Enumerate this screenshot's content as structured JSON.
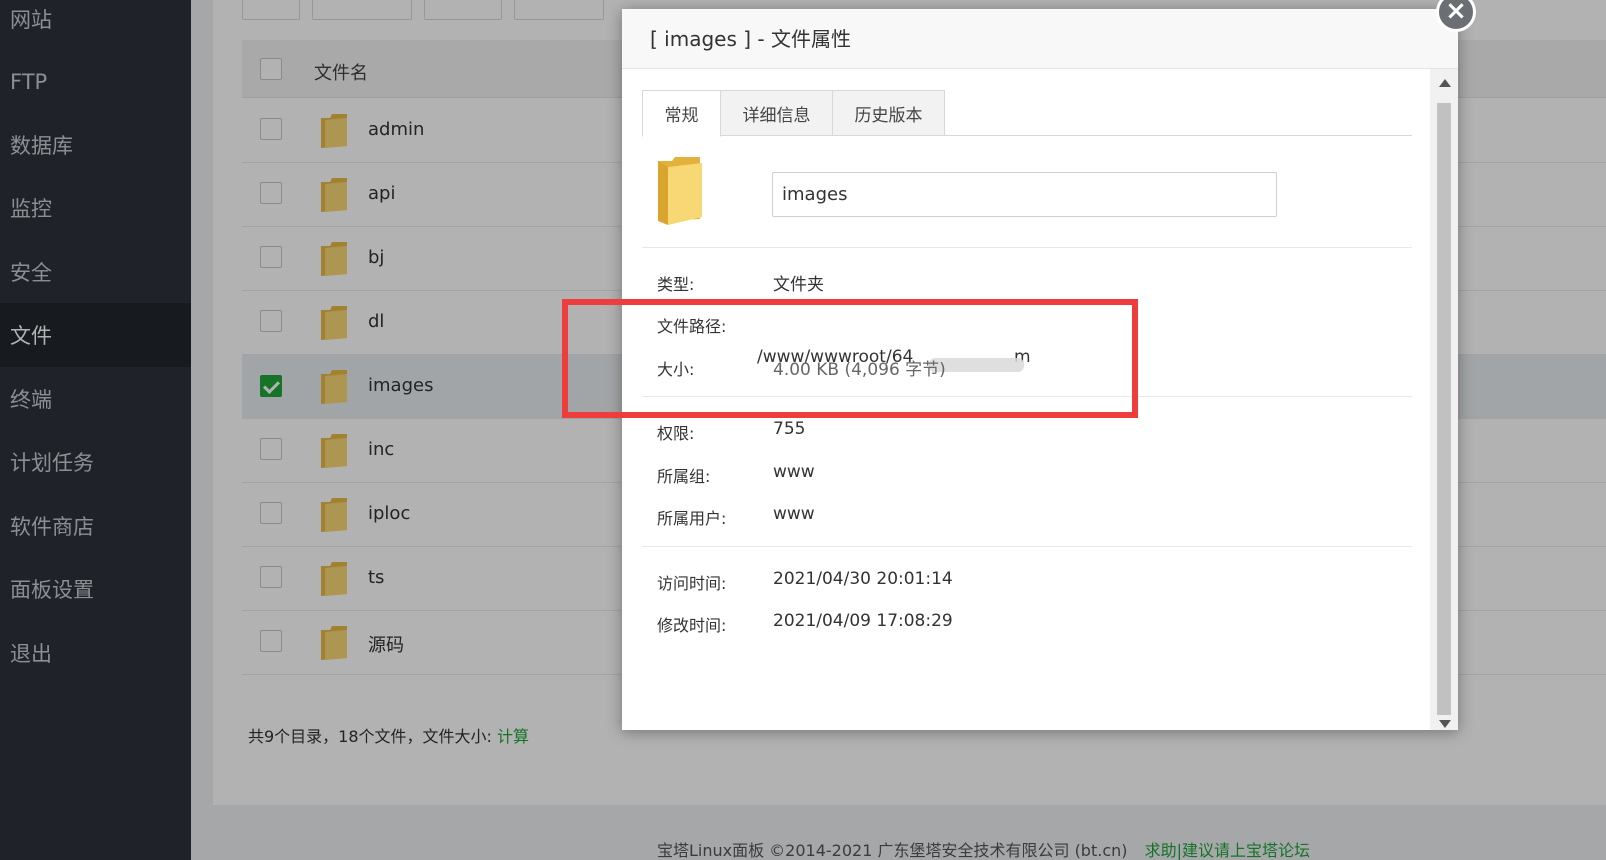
{
  "sidebar": {
    "items": [
      {
        "label": "网站"
      },
      {
        "label": "FTP"
      },
      {
        "label": "数据库"
      },
      {
        "label": "监控"
      },
      {
        "label": "安全"
      },
      {
        "label": "文件",
        "active": true
      },
      {
        "label": "终端"
      },
      {
        "label": "计划任务"
      },
      {
        "label": "软件商店"
      },
      {
        "label": "面板设置"
      },
      {
        "label": "退出"
      }
    ]
  },
  "file_list": {
    "header": {
      "name_col": "文件名"
    },
    "rows": [
      {
        "name": "admin",
        "checked": false
      },
      {
        "name": "api",
        "checked": false
      },
      {
        "name": "bj",
        "checked": false
      },
      {
        "name": "dl",
        "checked": false
      },
      {
        "name": "images",
        "checked": true
      },
      {
        "name": "inc",
        "checked": false
      },
      {
        "name": "iploc",
        "checked": false
      },
      {
        "name": "ts",
        "checked": false
      },
      {
        "name": "源码",
        "checked": false
      }
    ],
    "summary_text": "共9个目录，18个文件，文件大小:",
    "calc_link": "计算"
  },
  "footer": {
    "copyright": "宝塔Linux面板 ©2014-2021 广东堡塔安全技术有限公司 (bt.cn)",
    "forum_link": "求助|建议请上宝塔论坛"
  },
  "dialog": {
    "title": "[ images ] - 文件属性",
    "close_glyph": "×",
    "tabs": [
      {
        "label": "常规",
        "active": true
      },
      {
        "label": "详细信息"
      },
      {
        "label": "历史版本"
      }
    ],
    "name_value": "images",
    "props": {
      "type_label": "类型:",
      "type_value": "文件夹",
      "path_label": "文件路径:",
      "path_value": "/www/wwwroot/64",
      "path_tail": "m",
      "size_label": "大小:",
      "size_value": "4.00 KB (4,096 字节)",
      "perm_label": "权限:",
      "perm_value": "755",
      "group_label": "所属组:",
      "group_value": "www",
      "owner_label": "所属用户:",
      "owner_value": "www",
      "atime_label": "访问时间:",
      "atime_value": "2021/04/30 20:01:14",
      "mtime_label": "修改时间:",
      "mtime_value": "2021/04/09 17:08:29"
    }
  },
  "colors": {
    "accent": "#20a53a",
    "highlight": "#ee3d3d",
    "sidebar_bg": "#2d333c"
  }
}
